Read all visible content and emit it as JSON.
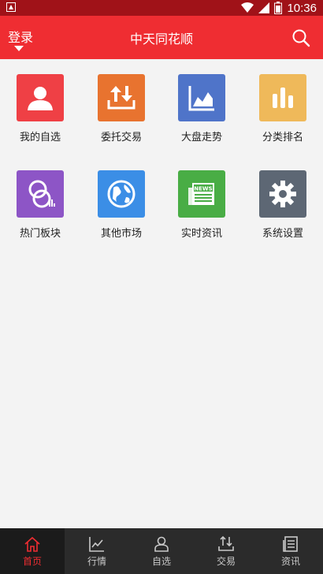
{
  "status_bar": {
    "time": "10:36"
  },
  "header": {
    "login_label": "登录",
    "title": "中天同花顺"
  },
  "colors": {
    "header_red": "#ef2d32",
    "statusbar_red": "#a01218",
    "tab_active": "#ef2d32"
  },
  "tiles": [
    {
      "label": "我的自选",
      "icon": "user-icon",
      "color": "#ef4045"
    },
    {
      "label": "委托交易",
      "icon": "trade-arrows-icon",
      "color": "#e8732f"
    },
    {
      "label": "大盘走势",
      "icon": "area-chart-icon",
      "color": "#4f74c9"
    },
    {
      "label": "分类排名",
      "icon": "bar-chart-icon",
      "color": "#efb95a"
    },
    {
      "label": "热门板块",
      "icon": "bubble-icon",
      "color": "#8d55c6"
    },
    {
      "label": "其他市场",
      "icon": "globe-icon",
      "color": "#3b8ee6"
    },
    {
      "label": "实时资讯",
      "icon": "news-icon",
      "color": "#49ad45"
    },
    {
      "label": "系统设置",
      "icon": "gear-icon",
      "color": "#5d6774"
    }
  ],
  "news_badge": "NEWS",
  "tabbar": [
    {
      "label": "首页",
      "icon": "home-icon",
      "active": true
    },
    {
      "label": "行情",
      "icon": "line-chart-icon",
      "active": false
    },
    {
      "label": "自选",
      "icon": "person-icon",
      "active": false
    },
    {
      "label": "交易",
      "icon": "exchange-icon",
      "active": false
    },
    {
      "label": "资讯",
      "icon": "document-icon",
      "active": false
    }
  ]
}
